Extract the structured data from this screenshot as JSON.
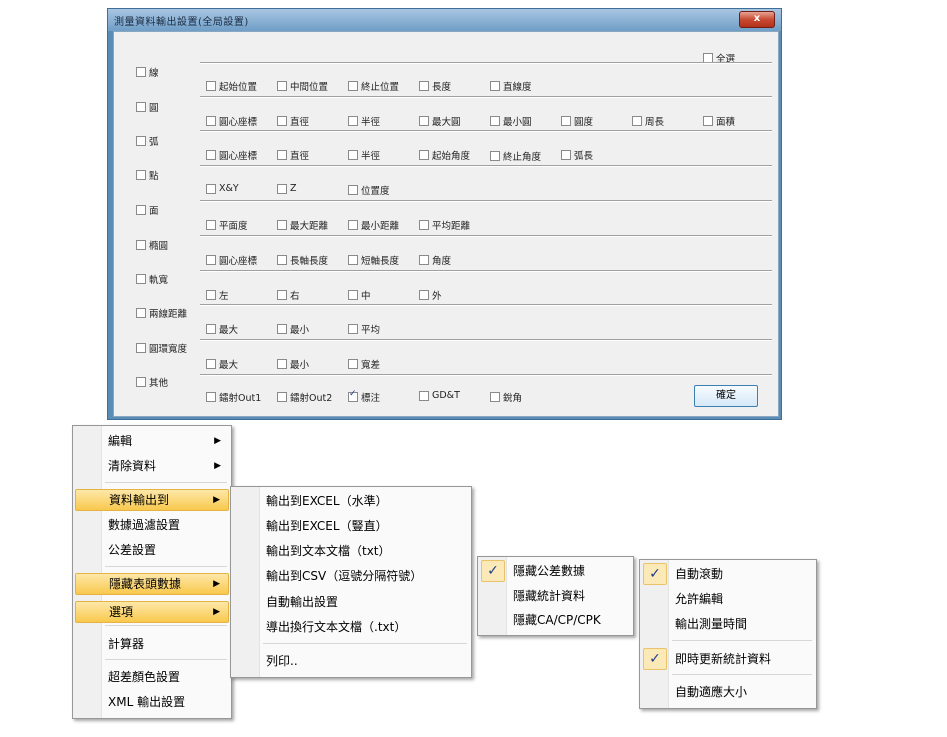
{
  "dialog": {
    "title": "測量資料輸出設置(全局設置)",
    "close_label": "x",
    "select_all": "全選",
    "confirm": "確定",
    "left_items": [
      "線",
      "圓",
      "弧",
      "點",
      "面",
      "橢圓",
      "軌寬",
      "兩線距離",
      "圓環寬度",
      "其他"
    ],
    "rows": [
      [
        "起始位置",
        "中間位置",
        "終止位置",
        "長度",
        "直線度"
      ],
      [
        "圓心座標",
        "直徑",
        "半徑",
        "最大圓",
        "最小圓",
        "圓度",
        "周長",
        "面積"
      ],
      [
        "圓心座標",
        "直徑",
        "半徑",
        "起始角度",
        "終止角度",
        "弧長"
      ],
      [
        "X&Y",
        "Z",
        "位置度"
      ],
      [
        "平面度",
        "最大距離",
        "最小距離",
        "平均距離"
      ],
      [
        "圓心座標",
        "長軸長度",
        "短軸長度",
        "角度"
      ],
      [
        "左",
        "右",
        "中",
        "外"
      ],
      [
        "最大",
        "最小",
        "平均"
      ],
      [
        "最大",
        "最小",
        "寬差"
      ],
      [
        "鐳射Out1",
        "鐳射Out2",
        "標注",
        "GD&T",
        "銳角"
      ]
    ],
    "checked": "標注"
  },
  "main_menu": {
    "items": [
      "編輯",
      "清除資料",
      "資料輸出到",
      "數據過濾設置",
      "公差設置",
      "隱藏表頭數據",
      "選項",
      "計算器",
      "超差顏色設置",
      "XML 輸出設置"
    ],
    "submenu_arrow": "▶"
  },
  "export_submenu": {
    "items": [
      "輸出到EXCEL（水準）",
      "輸出到EXCEL（豎直）",
      "輸出到文本文檔（txt）",
      "輸出到CSV（逗號分隔符號）",
      "自動輸出設置",
      "導出換行文本文檔（.txt）",
      "列印.."
    ]
  },
  "hide_submenu": {
    "items": [
      "隱藏公差數據",
      "隱藏統計資料",
      "隱藏CA/CP/CPK"
    ],
    "check_mark": "✓"
  },
  "options_submenu": {
    "items": [
      "自動滾動",
      "允許編輯",
      "輸出測量時間",
      "即時更新統計資料",
      "自動適應大小"
    ],
    "check_mark": "✓"
  },
  "colors": {
    "highlight": "#f9c84d",
    "title_bar": "#6f9ec7",
    "close_button": "#c84a32"
  }
}
